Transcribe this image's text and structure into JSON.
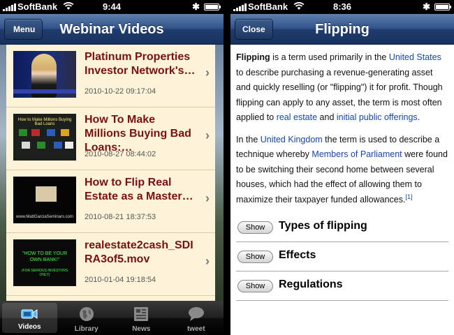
{
  "left": {
    "status": {
      "carrier": "SoftBank",
      "time": "9:44"
    },
    "nav": {
      "back_label": "Menu",
      "title": "Webinar Videos"
    },
    "videos": [
      {
        "title": "Platinum Properties Investor Network's…",
        "date": "2010-10-22 09:17:04"
      },
      {
        "title": "How To Make Millions Buying Bad Loans:…",
        "date": "2010-08-27 08:44:02",
        "thumb_caption": "How to Make Millions Buying Bad Loans"
      },
      {
        "title": "How to Flip Real Estate as a Master…",
        "date": "2010-08-21 18:37:53",
        "thumb_caption": "www.MattGarciaSeminars.com"
      },
      {
        "title": "realestate2cash_SDIRA3of5.mov",
        "date": "2010-01-04 19:18:54",
        "thumb_caption": "\"HOW TO BE YOUR OWN BANK!\"",
        "thumb_caption2": "(FOR SERIOUS INVESTORS ONLY)"
      }
    ],
    "tabs": [
      {
        "label": "Videos",
        "icon": "video-camera-icon",
        "active": true
      },
      {
        "label": "Library",
        "icon": "globe-icon",
        "active": false
      },
      {
        "label": "News",
        "icon": "newspaper-icon",
        "active": false
      },
      {
        "label": "tweet",
        "icon": "speech-bubble-icon",
        "active": false
      }
    ]
  },
  "right": {
    "status": {
      "carrier": "SoftBank",
      "time": "8:36"
    },
    "nav": {
      "close_label": "Close",
      "title": "Flipping"
    },
    "article": {
      "p1": {
        "term": "Flipping",
        "t1": " is a term used primarily in the ",
        "l1": "United States",
        "t2": " to describe purchasing a revenue-generating asset and quickly reselling (or \"flipping\") it for profit. Though flipping can apply to any asset, the term is most often applied to ",
        "l2": "real estate",
        "t3": " and ",
        "l3": "initial public offerings",
        "t4": "."
      },
      "p2": {
        "t1": "In the ",
        "l1": "United Kingdom",
        "t2": " the term is used to describe a technique whereby ",
        "l2": "Members of Parliament",
        "t3": " were found to be switching their second home between several houses, which had the effect of allowing them to maximize their taxpayer funded allowances.",
        "ref": "[1]"
      },
      "sections": [
        {
          "button": "Show",
          "title": "Types of flipping"
        },
        {
          "button": "Show",
          "title": "Effects"
        },
        {
          "button": "Show",
          "title": "Regulations"
        }
      ]
    }
  },
  "colors": {
    "nav_blue": "#1e3c6e",
    "list_bg": "#fdf3d8",
    "video_title": "#7a1010",
    "link": "#1545b5"
  }
}
